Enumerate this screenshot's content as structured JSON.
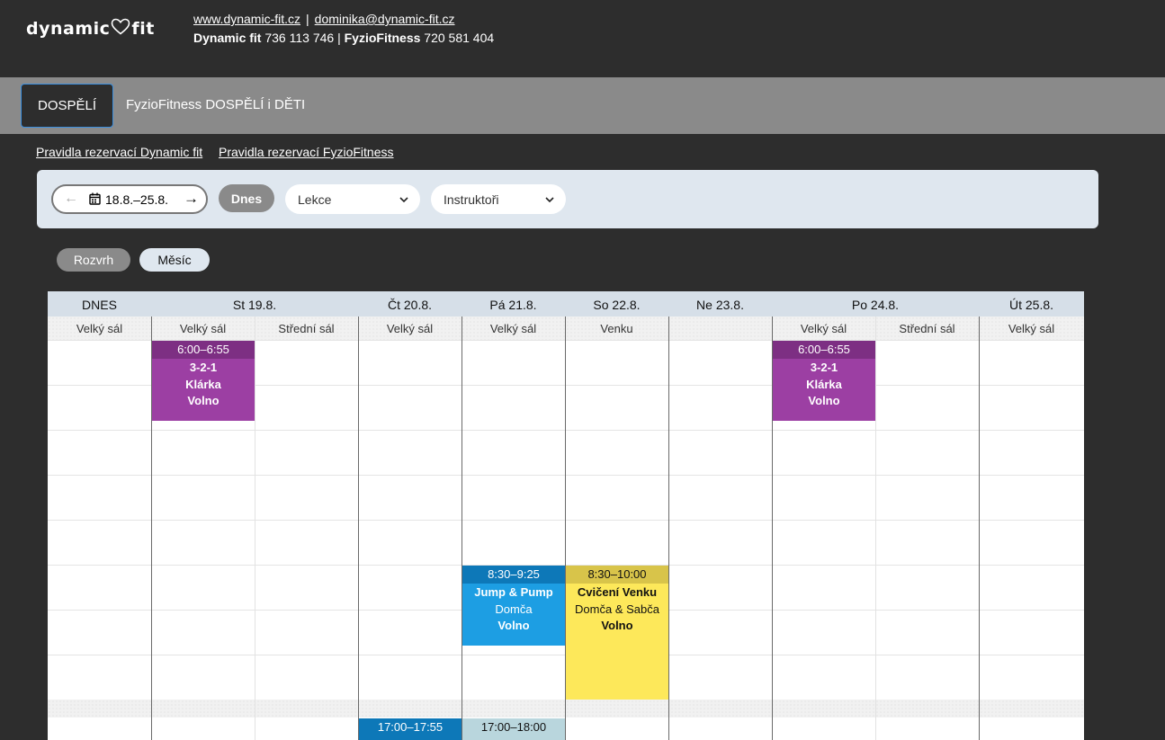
{
  "header": {
    "logo_left": "dynamic",
    "logo_right": "fit",
    "website": "www.dynamic-fit.cz",
    "email": "dominika@dynamic-fit.cz",
    "separator": "|",
    "phone1_label": "Dynamic fit",
    "phone1": "736 113 746",
    "phone2_label": "FyzioFitness",
    "phone2": "720 581 404"
  },
  "tabs": [
    {
      "label": "DOSPĚLÍ",
      "active": true
    },
    {
      "label": "FyzioFitness DOSPĚLÍ i DĚTI",
      "active": false
    }
  ],
  "rules_links": [
    "Pravidla rezervací Dynamic fit",
    "Pravidla rezervací FyzioFitness"
  ],
  "filters": {
    "date_range": "18.8.–25.8.",
    "today_button": "Dnes",
    "lesson_select": "Lekce",
    "instructor_select": "Instruktoři"
  },
  "views": [
    {
      "label": "Rozvrh",
      "active": true
    },
    {
      "label": "Měsíc",
      "active": false
    }
  ],
  "calendar": {
    "days": [
      {
        "label": "DNES",
        "bold": true,
        "muted": false
      },
      {
        "label": "St 19.8.",
        "bold": false,
        "muted": false
      },
      {
        "label": "Čt 20.8.",
        "bold": false,
        "muted": false
      },
      {
        "label": "Pá 21.8.",
        "bold": false,
        "muted": false
      },
      {
        "label": "So 22.8.",
        "bold": false,
        "muted": true
      },
      {
        "label": "Ne 23.8.",
        "bold": false,
        "muted": true
      },
      {
        "label": "Po 24.8.",
        "bold": false,
        "muted": false
      },
      {
        "label": "Út 25.8.",
        "bold": false,
        "muted": false
      }
    ],
    "rooms": [
      "Velký sál",
      "Velký sál",
      "Střední sál",
      "Velký sál",
      "Velký sál",
      "Venku",
      "",
      "Velký sál",
      "Střední sál",
      "Velký sál"
    ],
    "events": [
      {
        "time": "6:00–6:55",
        "name": "3-2-1",
        "instructor": "Klárka",
        "status": "Volno",
        "header_color": "#7d2f83",
        "body_color": "#9c3fa3",
        "text_color": "#ffffff"
      },
      {
        "time": "6:00–6:55",
        "name": "3-2-1",
        "instructor": "Klárka",
        "status": "Volno",
        "header_color": "#7d2f83",
        "body_color": "#9c3fa3",
        "text_color": "#ffffff"
      },
      {
        "time": "8:30–9:25",
        "name": "Jump & Pump",
        "instructor": "Domča",
        "status": "Volno",
        "header_color": "#0d78b8",
        "body_color": "#1d9ee3",
        "text_color": "#ffffff"
      },
      {
        "time": "8:30–10:00",
        "name": "Cvičení Venku",
        "instructor": "Domča & Sabča",
        "status": "Volno",
        "header_color": "#d8c44a",
        "body_color": "#fde85a",
        "text_color": "#111111"
      },
      {
        "time": "17:00–17:55",
        "header_color": "#0d78b8",
        "text_color": "#ffffff"
      },
      {
        "time": "17:00–18:00",
        "header_color": "#b9d6dd",
        "text_color": "#111111"
      }
    ]
  }
}
